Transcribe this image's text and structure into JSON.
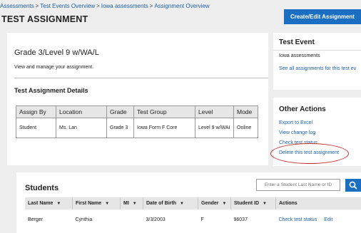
{
  "breadcrumb": {
    "items": [
      "Assessments",
      "Test Events Overview",
      "Iowa assessments",
      "Assignment Overview"
    ],
    "separator": ">"
  },
  "page_title": "TEST ASSIGNMENT",
  "create_button": "Create/Edit Assignment",
  "assignment": {
    "title": "Grade 3/Level 9 w/WA/L",
    "description": "View and manage your assignment.",
    "details_heading": "Test Assignment Details",
    "columns": [
      "Assign By",
      "Location",
      "Grade",
      "Test Group",
      "Level",
      "Mode"
    ],
    "row": [
      "Student",
      "Ms. Lan",
      "Grade 3",
      "Iowa Form F Core",
      "Level 9 w/WAI",
      "Online"
    ]
  },
  "test_event": {
    "heading": "Test Event",
    "name": "Iowa assessments",
    "link": "See all assignments for this test ev"
  },
  "other_actions": {
    "heading": "Other Actions",
    "items": [
      "Export to Excel",
      "View change log",
      "Check test status",
      "Delete this test assignment"
    ]
  },
  "students": {
    "heading": "Students",
    "search_placeholder": "Enter a Student Last Name or ID",
    "columns": [
      "Last Name",
      "First Name",
      "MI",
      "Date of Birth",
      "Gender",
      "Student ID",
      "Actions"
    ],
    "rows": [
      {
        "last": "Berger",
        "first": "Cynthia",
        "mi": "",
        "dob": "3/3/2003",
        "gender": "F",
        "id": "96037",
        "action1": "Check test status",
        "action2": "Edit"
      }
    ]
  },
  "colors": {
    "accent": "#1a6fc2",
    "link": "#1a5fa8",
    "highlight_ring": "#c83232"
  },
  "icons": {
    "search": "search-icon",
    "sort": "sort-down-icon"
  }
}
